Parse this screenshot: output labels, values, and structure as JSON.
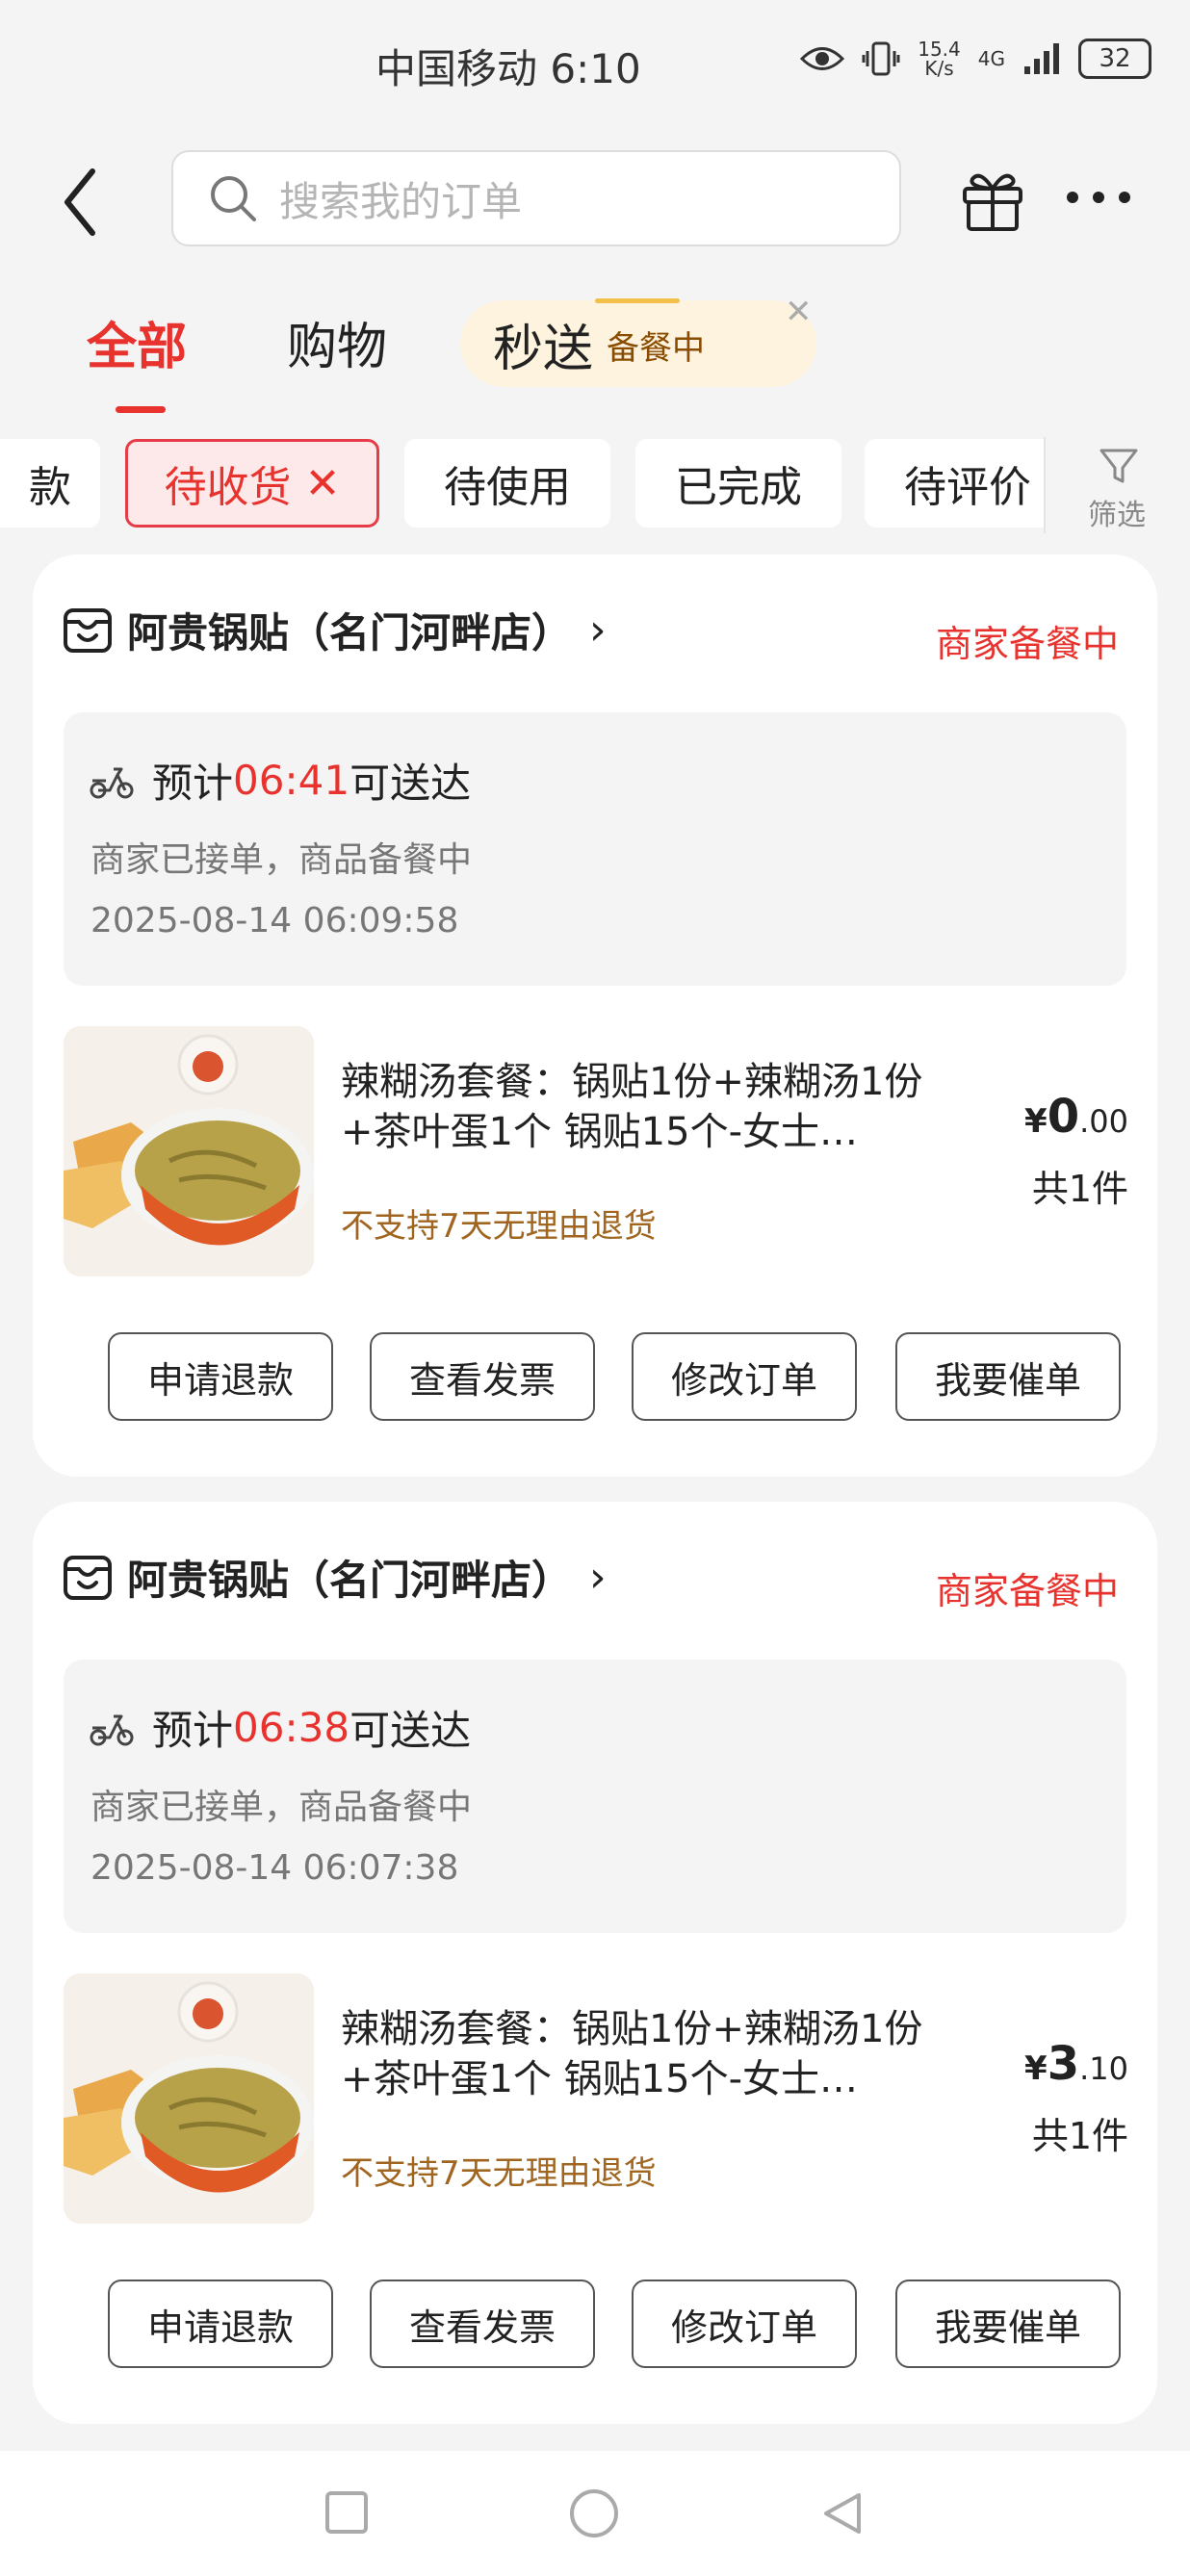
{
  "status_bar": {
    "carrier_time": "中国移动 6:10",
    "speed_value": "15.4",
    "speed_unit": "K/s",
    "network": "4G",
    "battery": "32"
  },
  "header": {
    "search_placeholder": "搜索我的订单"
  },
  "tabs": {
    "all": "全部",
    "shopping": "购物",
    "flash": "秒送",
    "flash_status": "备餐中"
  },
  "filters": {
    "partial": "款",
    "pending_receipt": "待收货",
    "to_use": "待使用",
    "completed": "已完成",
    "to_review": "待评价",
    "filter_label": "筛选"
  },
  "orders": [
    {
      "shop": "阿贵锅贴（名门河畔店）",
      "status": "商家备餐中",
      "eta_prefix": "预计",
      "eta_time": "06:41",
      "eta_suffix": "可送达",
      "progress": "商家已接单，商品备餐中",
      "timestamp": "2025-08-14 06:09:58",
      "product_title": "辣糊汤套餐：锅贴1份+辣糊汤1份+茶叶蛋1个 锅贴15个-女士…",
      "product_note": "不支持7天无理由退货",
      "currency": "¥",
      "price_int": "0",
      "price_dec": ".00",
      "quantity": "共1件",
      "buttons": [
        "申请退款",
        "查看发票",
        "修改订单",
        "我要催单"
      ]
    },
    {
      "shop": "阿贵锅贴（名门河畔店）",
      "status": "商家备餐中",
      "eta_prefix": "预计",
      "eta_time": "06:38",
      "eta_suffix": "可送达",
      "progress": "商家已接单，商品备餐中",
      "timestamp": "2025-08-14 06:07:38",
      "product_title": "辣糊汤套餐：锅贴1份+辣糊汤1份+茶叶蛋1个 锅贴15个-女士…",
      "product_note": "不支持7天无理由退货",
      "currency": "¥",
      "price_int": "3",
      "price_dec": ".10",
      "quantity": "共1件",
      "buttons": [
        "申请退款",
        "查看发票",
        "修改订单",
        "我要催单"
      ]
    }
  ],
  "colors": {
    "accent": "#e8322e",
    "note": "#a0661f",
    "background": "#f4f4f4"
  }
}
